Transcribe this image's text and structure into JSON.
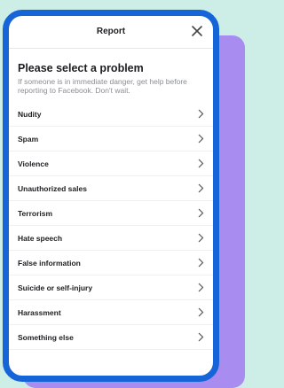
{
  "dialog": {
    "title": "Report",
    "heading": "Please select a problem",
    "subtext": "If someone is in immediate danger, get help before reporting to Facebook. Don't wait."
  },
  "items": [
    {
      "label": "Nudity"
    },
    {
      "label": "Spam"
    },
    {
      "label": "Violence"
    },
    {
      "label": "Unauthorized sales"
    },
    {
      "label": "Terrorism"
    },
    {
      "label": "Hate speech"
    },
    {
      "label": "False information"
    },
    {
      "label": "Suicide or self-injury"
    },
    {
      "label": "Harassment"
    },
    {
      "label": "Something else"
    }
  ],
  "icons": {
    "close": "close-icon",
    "row": "chevron-right-icon"
  },
  "colors": {
    "frame": "#1565d8",
    "accent_shadow": "#a98cf0",
    "background": "#cdeee6"
  }
}
